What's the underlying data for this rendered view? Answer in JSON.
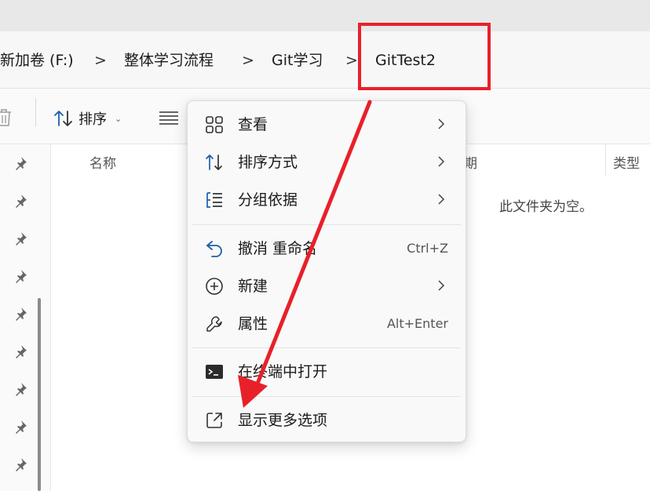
{
  "breadcrumb": {
    "items": [
      "新加卷 (F:)",
      "整体学习流程",
      "Git学习",
      "GitTest2"
    ],
    "separator": ">"
  },
  "toolbar": {
    "sort_label": "排序",
    "sort_chevron": "⌄"
  },
  "columns": {
    "name": "名称",
    "date": "期",
    "type": "类型"
  },
  "empty_message": "此文件夹为空。",
  "context_menu": {
    "items": [
      {
        "label": "查看",
        "icon": "grid-view-icon",
        "submenu": true
      },
      {
        "label": "排序方式",
        "icon": "sort-icon",
        "submenu": true
      },
      {
        "label": "分组依据",
        "icon": "group-by-icon",
        "submenu": true
      },
      {
        "label": "撤消 重命名",
        "icon": "undo-icon",
        "shortcut": "Ctrl+Z"
      },
      {
        "label": "新建",
        "icon": "new-icon",
        "submenu": true
      },
      {
        "label": "属性",
        "icon": "wrench-icon",
        "shortcut": "Alt+Enter"
      },
      {
        "label": "在终端中打开",
        "icon": "terminal-icon"
      },
      {
        "label": "显示更多选项",
        "icon": "more-options-icon"
      }
    ]
  },
  "colors": {
    "annotation_red": "#e8202a",
    "icon_blue": "#1d5fa8"
  }
}
